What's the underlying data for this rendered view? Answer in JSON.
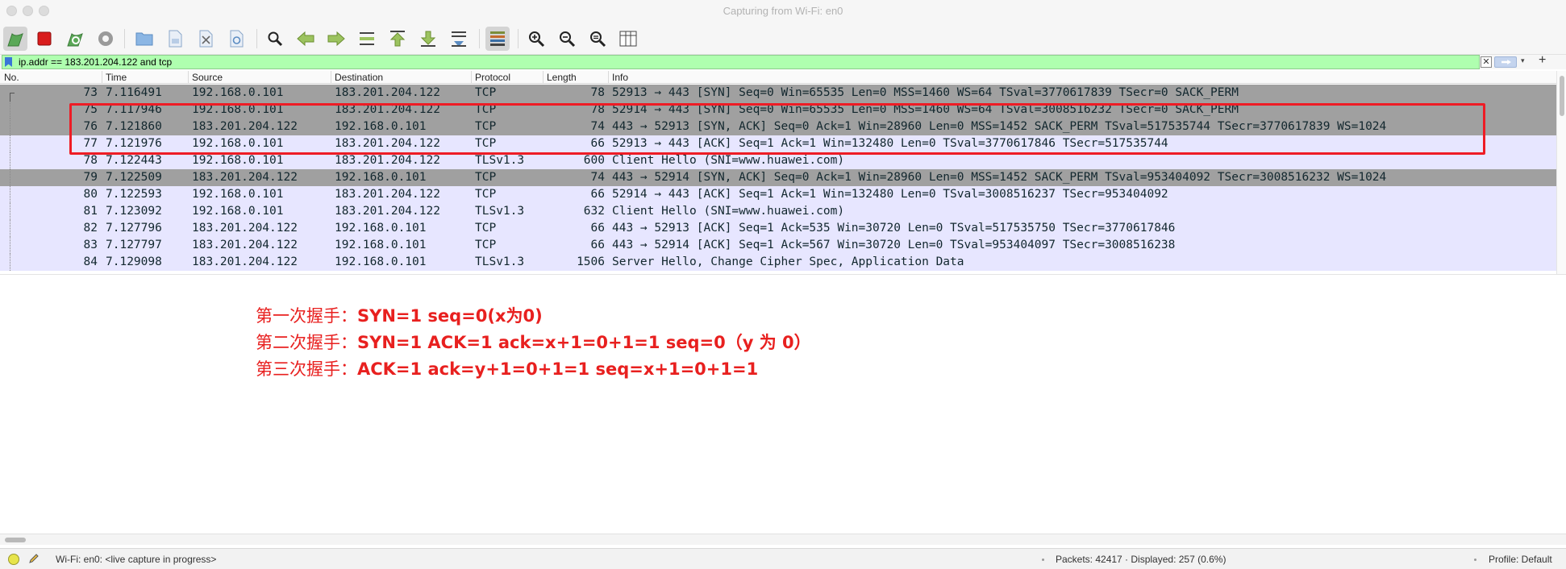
{
  "window": {
    "title": "Capturing from Wi-Fi: en0"
  },
  "toolbar": {
    "icons": [
      "start-capture-icon",
      "stop-capture-icon",
      "restart-capture-icon",
      "capture-options-icon",
      "open-file-icon",
      "save-file-icon",
      "close-file-icon",
      "reload-file-icon",
      "find-packet-icon",
      "go-back-icon",
      "go-forward-icon",
      "go-to-packet-icon",
      "go-first-icon",
      "go-last-icon",
      "auto-scroll-icon",
      "colorize-icon",
      "zoom-in-icon",
      "zoom-out-icon",
      "normal-size-icon",
      "resize-columns-icon"
    ]
  },
  "filter": {
    "value": "ip.addr == 183.201.204.122 and tcp"
  },
  "columns": [
    "No.",
    "Time",
    "Source",
    "Destination",
    "Protocol",
    "Length",
    "Info"
  ],
  "packets": [
    {
      "no": "73",
      "time": "7.116491",
      "src": "192.168.0.101",
      "dst": "183.201.204.122",
      "proto": "TCP",
      "len": "78",
      "info": "52913 → 443 [SYN] Seq=0 Win=65535 Len=0 MSS=1460 WS=64 TSval=3770617839 TSecr=0 SACK_PERM",
      "color": "syn"
    },
    {
      "no": "75",
      "time": "7.117946",
      "src": "192.168.0.101",
      "dst": "183.201.204.122",
      "proto": "TCP",
      "len": "78",
      "info": "52914 → 443 [SYN] Seq=0 Win=65535 Len=0 MSS=1460 WS=64 TSval=3008516232 TSecr=0 SACK_PERM",
      "color": "syn"
    },
    {
      "no": "76",
      "time": "7.121860",
      "src": "183.201.204.122",
      "dst": "192.168.0.101",
      "proto": "TCP",
      "len": "74",
      "info": "443 → 52913 [SYN, ACK] Seq=0 Ack=1 Win=28960 Len=0 MSS=1452 SACK_PERM TSval=517535744 TSecr=3770617839 WS=1024",
      "color": "syn"
    },
    {
      "no": "77",
      "time": "7.121976",
      "src": "192.168.0.101",
      "dst": "183.201.204.122",
      "proto": "TCP",
      "len": "66",
      "info": "52913 → 443 [ACK] Seq=1 Ack=1 Win=132480 Len=0 TSval=3770617846 TSecr=517535744",
      "color": "tcp"
    },
    {
      "no": "78",
      "time": "7.122443",
      "src": "192.168.0.101",
      "dst": "183.201.204.122",
      "proto": "TLSv1.3",
      "len": "600",
      "info": "Client Hello (SNI=www.huawei.com)",
      "color": "tcp"
    },
    {
      "no": "79",
      "time": "7.122509",
      "src": "183.201.204.122",
      "dst": "192.168.0.101",
      "proto": "TCP",
      "len": "74",
      "info": "443 → 52914 [SYN, ACK] Seq=0 Ack=1 Win=28960 Len=0 MSS=1452 SACK_PERM TSval=953404092 TSecr=3008516232 WS=1024",
      "color": "syn"
    },
    {
      "no": "80",
      "time": "7.122593",
      "src": "192.168.0.101",
      "dst": "183.201.204.122",
      "proto": "TCP",
      "len": "66",
      "info": "52914 → 443 [ACK] Seq=1 Ack=1 Win=132480 Len=0 TSval=3008516237 TSecr=953404092",
      "color": "tcp"
    },
    {
      "no": "81",
      "time": "7.123092",
      "src": "192.168.0.101",
      "dst": "183.201.204.122",
      "proto": "TLSv1.3",
      "len": "632",
      "info": "Client Hello (SNI=www.huawei.com)",
      "color": "tcp"
    },
    {
      "no": "82",
      "time": "7.127796",
      "src": "183.201.204.122",
      "dst": "192.168.0.101",
      "proto": "TCP",
      "len": "66",
      "info": "443 → 52913 [ACK] Seq=1 Ack=535 Win=30720 Len=0 TSval=517535750 TSecr=3770617846",
      "color": "tcp"
    },
    {
      "no": "83",
      "time": "7.127797",
      "src": "183.201.204.122",
      "dst": "192.168.0.101",
      "proto": "TCP",
      "len": "66",
      "info": "443 → 52914 [ACK] Seq=1 Ack=567 Win=30720 Len=0 TSval=953404097 TSecr=3008516238",
      "color": "tcp"
    },
    {
      "no": "84",
      "time": "7.129098",
      "src": "183.201.204.122",
      "dst": "192.168.0.101",
      "proto": "TLSv1.3",
      "len": "1506",
      "info": "Server Hello, Change Cipher Spec, Application Data",
      "color": "tcp"
    }
  ],
  "annotations": [
    {
      "prefix": "第一次握手：",
      "body": "SYN=1 seq=0(x为0)"
    },
    {
      "prefix": "第二次握手：",
      "body": "SYN=1 ACK=1 ack=x+1=0+1=1 seq=0（y 为 0）"
    },
    {
      "prefix": "第三次握手：",
      "body": "ACK=1 ack=y+1=0+1=1  seq=x+1=0+1=1"
    }
  ],
  "status": {
    "interface": "Wi-Fi: en0: <live capture in progress>",
    "packets": "Packets: 42417 · Displayed: 257 (0.6%)",
    "profile": "Profile: Default"
  },
  "colors": {
    "syn_row": "#a0a0a0",
    "tcp_row": "#e7e6ff",
    "filter_ok": "#afffaf",
    "annotation": "#e8201f"
  }
}
